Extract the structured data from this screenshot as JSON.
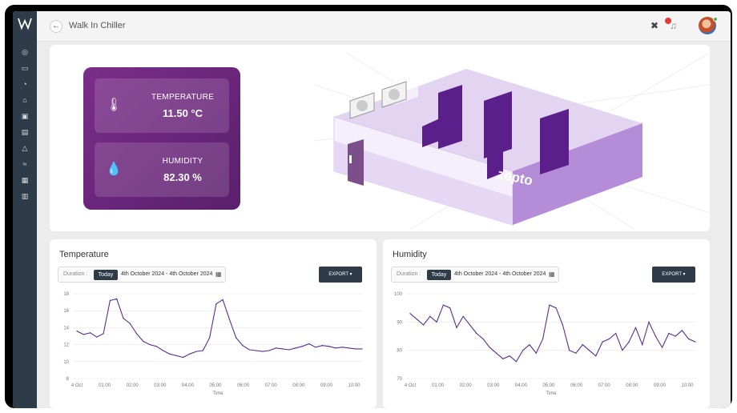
{
  "header": {
    "title": "Walk In Chiller",
    "back_icon": "arrow-left-icon",
    "notification_count_color": "#e53935"
  },
  "sidebar": {
    "items": [
      "dashboard-icon",
      "monitor-icon",
      "history-icon",
      "home-icon",
      "device-icon",
      "report-icon",
      "alert-icon",
      "analytics-icon",
      "grid-icon",
      "layers-icon"
    ]
  },
  "sensors": {
    "temperature": {
      "label": "TEMPERATURE",
      "value": "11.50 °C",
      "icon": "thermometer-icon"
    },
    "humidity": {
      "label": "HUMIDITY",
      "value": "82.30 %",
      "icon": "droplet-icon"
    }
  },
  "illustration": {
    "brand": "zepto",
    "accent": "#7b2d8a"
  },
  "controls": {
    "duration_label": "Duration :",
    "today_label": "Today",
    "range": "4th October 2024 - 4th October 2024",
    "export_label": "EXPORT ▾"
  },
  "charts": {
    "x_axis_label": "Time",
    "x_ticks": [
      "4 Oct",
      "01:00",
      "02:00",
      "03:00",
      "04:00",
      "05:00",
      "06:00",
      "07:00",
      "08:00",
      "09:00",
      "10:00"
    ]
  },
  "chart_data": [
    {
      "type": "line",
      "title": "Temperature",
      "xlabel": "Time",
      "ylabel": "",
      "ylim": [
        8,
        18
      ],
      "yticks": [
        8,
        10,
        12,
        14,
        16,
        18
      ],
      "x": [
        "00:00",
        "00:15",
        "00:30",
        "00:45",
        "01:00",
        "01:15",
        "01:30",
        "01:45",
        "02:00",
        "02:15",
        "02:30",
        "02:45",
        "03:00",
        "03:15",
        "03:30",
        "03:45",
        "04:00",
        "04:15",
        "04:30",
        "04:45",
        "05:00",
        "05:15",
        "05:30",
        "05:45",
        "06:00",
        "06:15",
        "06:30",
        "06:45",
        "07:00",
        "07:15",
        "07:30",
        "07:45",
        "08:00",
        "08:15",
        "08:30",
        "08:45",
        "09:00",
        "09:15",
        "09:30",
        "09:45",
        "10:00",
        "10:15",
        "10:30",
        "10:45"
      ],
      "series": [
        {
          "values": [
            13.6,
            13.2,
            13.4,
            12.9,
            13.3,
            17.2,
            17.4,
            15.1,
            14.5,
            13.3,
            12.4,
            12.0,
            11.8,
            11.3,
            10.9,
            10.7,
            10.5,
            10.9,
            11.2,
            11.3,
            12.8,
            16.8,
            17.3,
            15.0,
            12.8,
            11.9,
            11.4,
            11.3,
            11.2,
            11.3,
            11.6,
            11.5,
            11.4,
            11.6,
            11.8,
            12.1,
            11.7,
            11.9,
            11.8,
            11.6,
            11.7,
            11.6,
            11.5,
            11.5
          ],
          "color": "#5c2d91"
        }
      ]
    },
    {
      "type": "line",
      "title": "Humidity",
      "xlabel": "Time",
      "ylabel": "",
      "ylim": [
        70,
        100
      ],
      "yticks": [
        70,
        80,
        90,
        100
      ],
      "x": [
        "00:00",
        "00:15",
        "00:30",
        "00:45",
        "01:00",
        "01:15",
        "01:30",
        "01:45",
        "02:00",
        "02:15",
        "02:30",
        "02:45",
        "03:00",
        "03:15",
        "03:30",
        "03:45",
        "04:00",
        "04:15",
        "04:30",
        "04:45",
        "05:00",
        "05:15",
        "05:30",
        "05:45",
        "06:00",
        "06:15",
        "06:30",
        "06:45",
        "07:00",
        "07:15",
        "07:30",
        "07:45",
        "08:00",
        "08:15",
        "08:30",
        "08:45",
        "09:00",
        "09:15",
        "09:30",
        "09:45",
        "10:00",
        "10:15",
        "10:30",
        "10:45"
      ],
      "series": [
        {
          "values": [
            93,
            91,
            89,
            92,
            90,
            96,
            95,
            88,
            92,
            89,
            86,
            84,
            81,
            79,
            77,
            78,
            76,
            80,
            82,
            79,
            84,
            96,
            95,
            89,
            80,
            79,
            82,
            80,
            78,
            83,
            84,
            86,
            80,
            83,
            88,
            82,
            90,
            85,
            81,
            86,
            85,
            87,
            84,
            83
          ],
          "color": "#5c2d91"
        }
      ]
    }
  ]
}
